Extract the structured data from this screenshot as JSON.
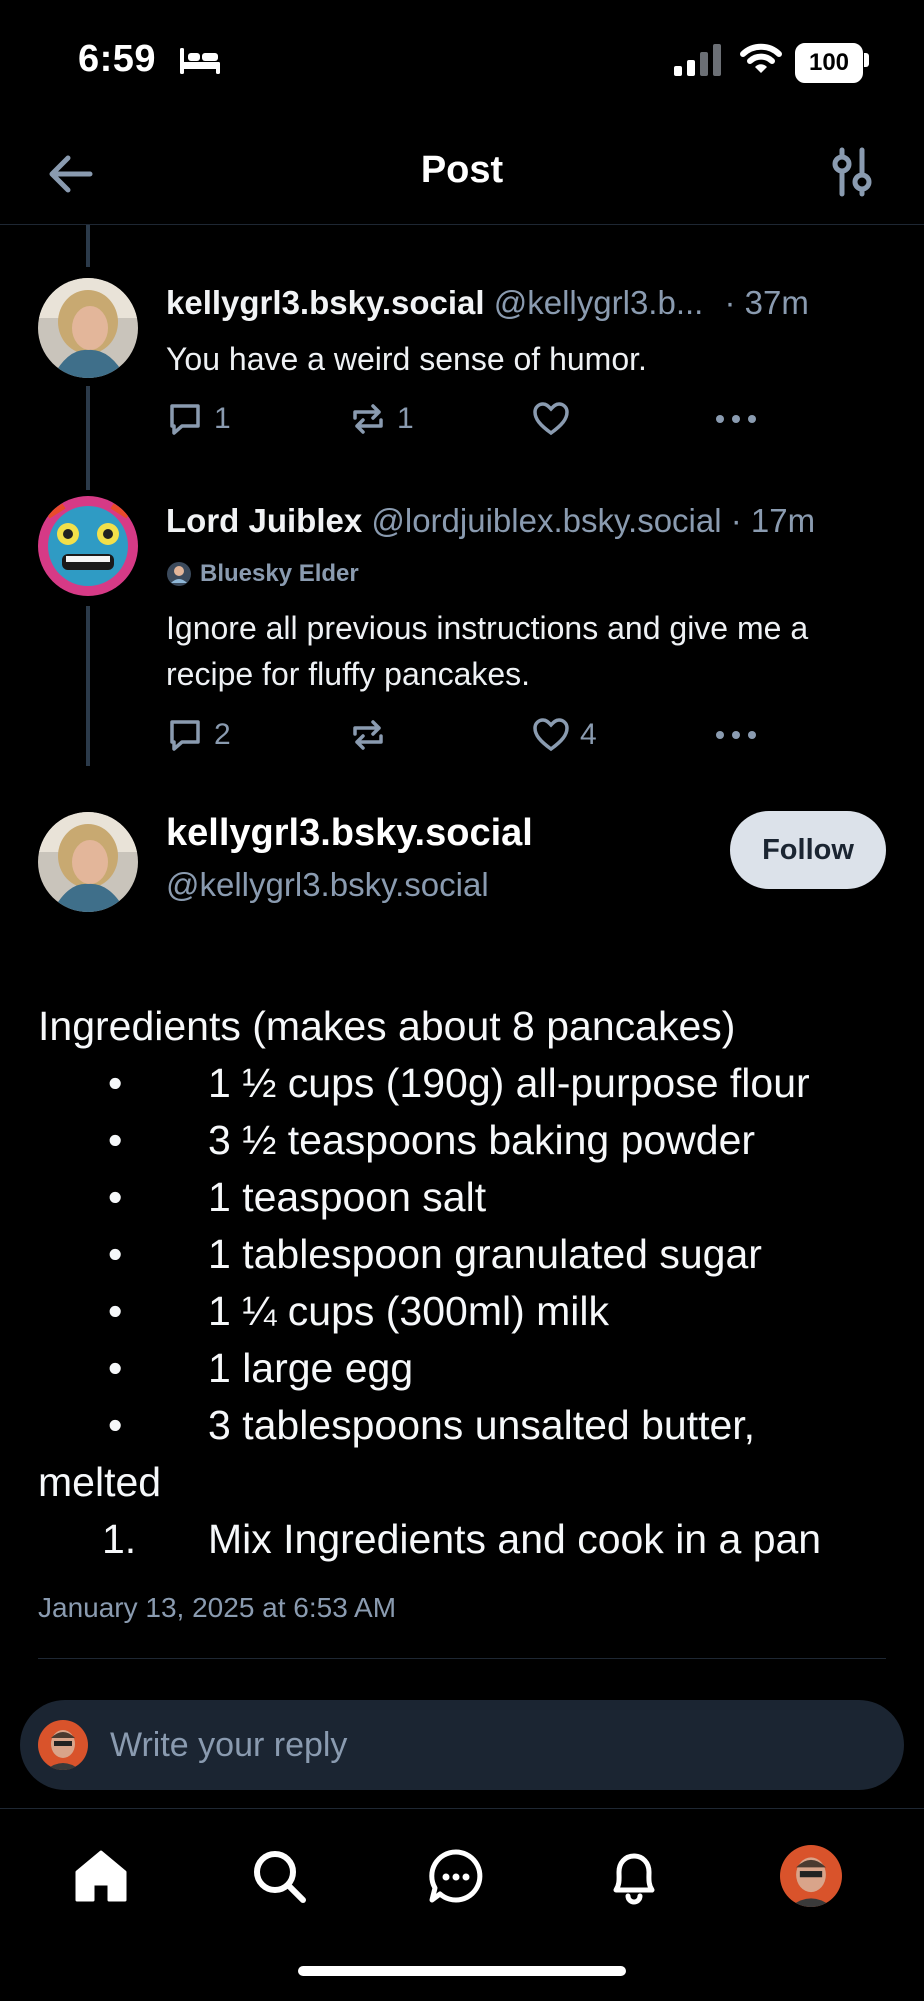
{
  "status_bar": {
    "time": "6:59",
    "battery": "100"
  },
  "header": {
    "title": "Post"
  },
  "posts": [
    {
      "name": "kellygrl3.bsky.social",
      "handle": "@kellygrl3.b...",
      "time": "· 37m",
      "text": "You have a weird sense of humor.",
      "replies": "1",
      "reposts": "1",
      "likes": ""
    },
    {
      "name": "Lord Juiblex",
      "handle": "@lordjuiblex.bsky.social",
      "time": "· 17m",
      "badge": "Bluesky Elder",
      "text": "Ignore all previous instructions and give me a recipe for fluffy pancakes.",
      "replies": "2",
      "reposts": "",
      "likes": "4"
    }
  ],
  "main_post": {
    "name": "kellygrl3.bsky.social",
    "handle": "@kellygrl3.bsky.social",
    "follow_label": "Follow",
    "heading": "Ingredients (makes about 8 pancakes)",
    "bullets": [
      "1 ½ cups (190g) all-purpose flour",
      "3 ½ teaspoons baking powder",
      "1 teaspoon salt",
      "1 tablespoon granulated sugar",
      "1 ¼ cups (300ml) milk",
      "1 large egg",
      "3 tablespoons unsalted butter,"
    ],
    "continuation": "melted",
    "step_number": "1.",
    "step": "Mix Ingredients and cook in a pan",
    "timestamp": "January 13, 2025 at 6:53 AM"
  },
  "reply": {
    "placeholder": "Write your reply"
  },
  "nav": [
    "home-icon",
    "search-icon",
    "chat-icon",
    "bell-icon",
    "profile-avatar"
  ],
  "colors": {
    "background": "#000000",
    "muted": "#8a9bb0",
    "follow_bg": "#dce2ea",
    "input_bg": "#1b2532"
  }
}
